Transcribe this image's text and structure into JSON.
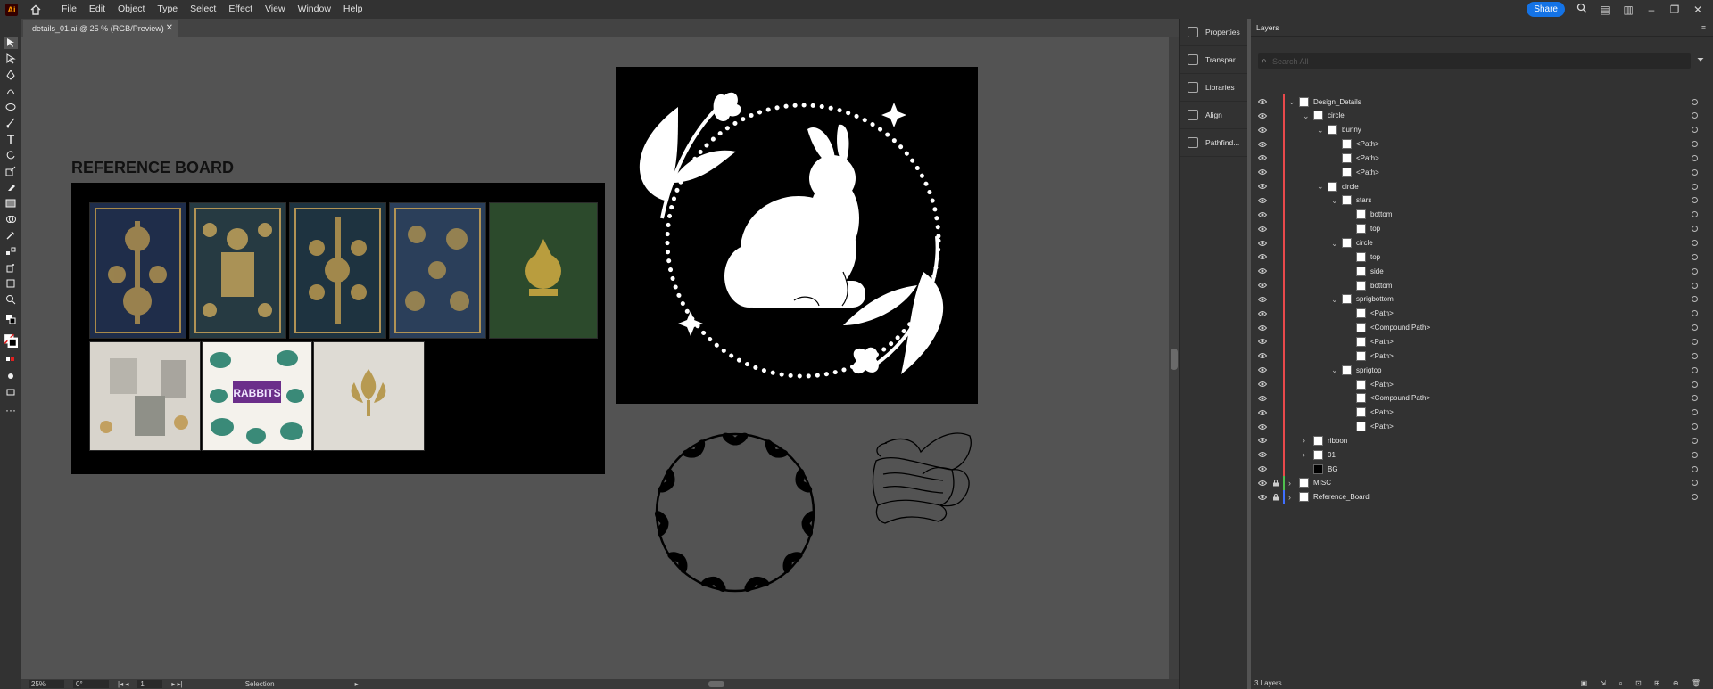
{
  "app": {
    "logo": "Ai",
    "title": "details_01.ai @ 25 % (RGB/Preview)"
  },
  "menu": [
    "File",
    "Edit",
    "Object",
    "Type",
    "Select",
    "Effect",
    "View",
    "Window",
    "Help"
  ],
  "share_label": "Share",
  "canvas": {
    "reference_title": "REFERENCE BOARD",
    "rabbits_text": "RABBITS"
  },
  "status": {
    "zoom": "25%",
    "rotation": "0°",
    "artboard": "1",
    "tool": "Selection"
  },
  "dock": [
    "Properties",
    "Transpar...",
    "Libraries",
    "Align",
    "Pathfind..."
  ],
  "layers_panel": {
    "tab": "Layers",
    "search_placeholder": "Search All",
    "footer": "3 Layers",
    "rows": [
      {
        "name": "Design_Details",
        "indent": 0,
        "twirl": "open",
        "color": "#e8494b"
      },
      {
        "name": "circle",
        "indent": 1,
        "twirl": "open",
        "color": "#e8494b"
      },
      {
        "name": "bunny",
        "indent": 2,
        "twirl": "open",
        "color": "#e8494b"
      },
      {
        "name": "<Path>",
        "indent": 3,
        "twirl": "",
        "color": "#e8494b"
      },
      {
        "name": "<Path>",
        "indent": 3,
        "twirl": "",
        "color": "#e8494b"
      },
      {
        "name": "<Path>",
        "indent": 3,
        "twirl": "",
        "color": "#e8494b"
      },
      {
        "name": "circle",
        "indent": 2,
        "twirl": "open",
        "color": "#e8494b"
      },
      {
        "name": "stars",
        "indent": 3,
        "twirl": "open",
        "color": "#e8494b"
      },
      {
        "name": "bottom",
        "indent": 4,
        "twirl": "",
        "color": "#e8494b"
      },
      {
        "name": "top",
        "indent": 4,
        "twirl": "",
        "color": "#e8494b"
      },
      {
        "name": "circle",
        "indent": 3,
        "twirl": "open",
        "color": "#e8494b"
      },
      {
        "name": "top",
        "indent": 4,
        "twirl": "",
        "color": "#e8494b"
      },
      {
        "name": "side",
        "indent": 4,
        "twirl": "",
        "color": "#e8494b"
      },
      {
        "name": "bottom",
        "indent": 4,
        "twirl": "",
        "color": "#e8494b"
      },
      {
        "name": "sprigbottom",
        "indent": 3,
        "twirl": "open",
        "color": "#e8494b"
      },
      {
        "name": "<Path>",
        "indent": 4,
        "twirl": "",
        "color": "#e8494b"
      },
      {
        "name": "<Compound Path>",
        "indent": 4,
        "twirl": "",
        "color": "#e8494b"
      },
      {
        "name": "<Path>",
        "indent": 4,
        "twirl": "",
        "color": "#e8494b"
      },
      {
        "name": "<Path>",
        "indent": 4,
        "twirl": "",
        "color": "#e8494b"
      },
      {
        "name": "sprigtop",
        "indent": 3,
        "twirl": "open",
        "color": "#e8494b"
      },
      {
        "name": "<Path>",
        "indent": 4,
        "twirl": "",
        "color": "#e8494b"
      },
      {
        "name": "<Compound Path>",
        "indent": 4,
        "twirl": "",
        "color": "#e8494b"
      },
      {
        "name": "<Path>",
        "indent": 4,
        "twirl": "",
        "color": "#e8494b"
      },
      {
        "name": "<Path>",
        "indent": 4,
        "twirl": "",
        "color": "#e8494b"
      },
      {
        "name": "ribbon",
        "indent": 1,
        "twirl": "closed",
        "color": "#e8494b"
      },
      {
        "name": "01",
        "indent": 1,
        "twirl": "closed",
        "color": "#e8494b"
      },
      {
        "name": "BG",
        "indent": 1,
        "twirl": "",
        "color": "#e8494b"
      },
      {
        "name": "MISC",
        "indent": 0,
        "twirl": "closed",
        "color": "#4fbf4f",
        "locked": true
      },
      {
        "name": "Reference_Board",
        "indent": 0,
        "twirl": "closed",
        "color": "#3f6fff",
        "locked": true
      }
    ]
  }
}
